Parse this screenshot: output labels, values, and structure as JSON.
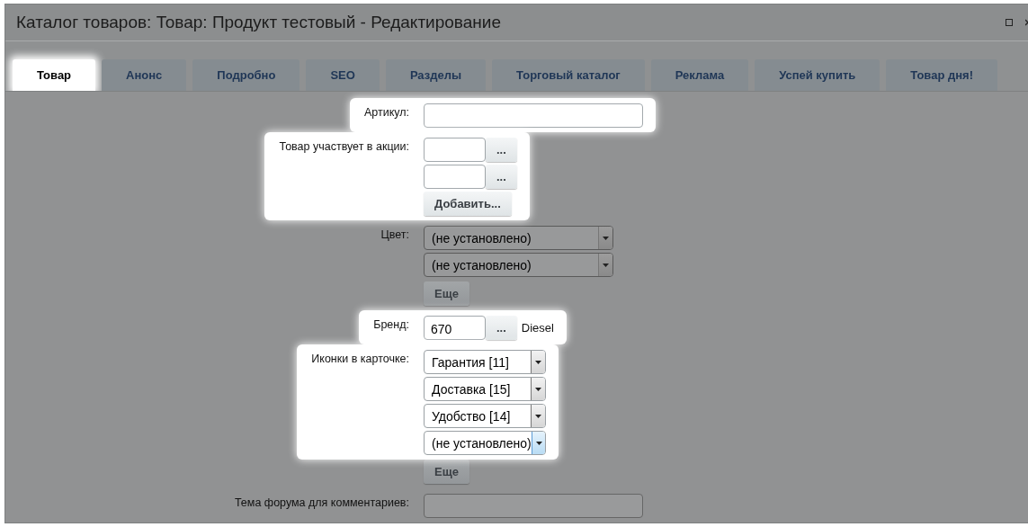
{
  "window": {
    "title": "Каталог товаров: Товар: Продукт тестовый - Редактирование"
  },
  "tabs": [
    {
      "label": "Товар",
      "selected": true
    },
    {
      "label": "Анонс",
      "selected": false
    },
    {
      "label": "Подробно",
      "selected": false
    },
    {
      "label": "SEO",
      "selected": false
    },
    {
      "label": "Разделы",
      "selected": false
    },
    {
      "label": "Торговый каталог",
      "selected": false
    },
    {
      "label": "Реклама",
      "selected": false
    },
    {
      "label": "Успей купить",
      "selected": false
    },
    {
      "label": "Товар дня!",
      "selected": false
    }
  ],
  "fields": [
    {
      "kind": "text",
      "label": "Артикул:",
      "highlighted": true
    },
    {
      "kind": "link_list",
      "label": "Товар участвует в акции:",
      "highlighted": true,
      "items": [
        {
          "pick": "..."
        },
        {
          "pick": "..."
        }
      ],
      "add_button": "Добавить..."
    },
    {
      "kind": "select_list",
      "label": "Цвет:",
      "highlighted": false,
      "options": [
        {
          "value": "(не установлено)",
          "focused": false
        },
        {
          "value": "(не установлено)",
          "focused": false
        }
      ],
      "more_button": "Еще"
    },
    {
      "kind": "link_list",
      "label": "Бренд:",
      "highlighted": true,
      "items": [
        {
          "value": "670",
          "pick": "...",
          "name": "Diesel"
        }
      ]
    },
    {
      "kind": "compact_select_list",
      "label": "Иконки в карточке:",
      "highlighted": true,
      "options": [
        {
          "value": "Гарантия [11]",
          "focused": false
        },
        {
          "value": "Доставка [15]",
          "focused": false
        },
        {
          "value": "Удобство [14]",
          "focused": false
        },
        {
          "value": "(не установлено)",
          "focused": true
        }
      ],
      "more_button": "Еще"
    },
    {
      "kind": "text",
      "label": "Тема форума для комментариев:",
      "highlighted": false
    }
  ]
}
